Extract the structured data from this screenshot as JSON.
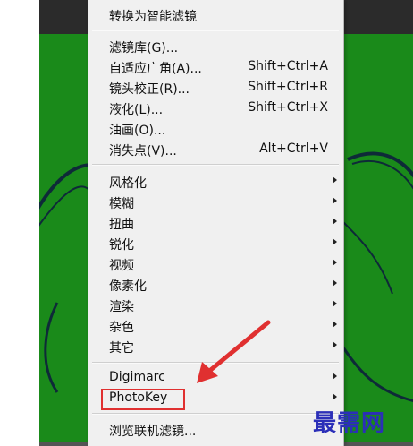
{
  "menu": {
    "items": [
      {
        "label": "转换为智能滤镜"
      },
      {
        "label": "滤镜库(G)..."
      },
      {
        "label": "自适应广角(A)...",
        "shortcut": "Shift+Ctrl+A"
      },
      {
        "label": "镜头校正(R)...",
        "shortcut": "Shift+Ctrl+R"
      },
      {
        "label": "液化(L)...",
        "shortcut": "Shift+Ctrl+X"
      },
      {
        "label": "油画(O)..."
      },
      {
        "label": "消失点(V)...",
        "shortcut": "Alt+Ctrl+V"
      },
      {
        "label": "风格化"
      },
      {
        "label": "模糊"
      },
      {
        "label": "扭曲"
      },
      {
        "label": "锐化"
      },
      {
        "label": "视频"
      },
      {
        "label": "像素化"
      },
      {
        "label": "渲染"
      },
      {
        "label": "杂色"
      },
      {
        "label": "其它"
      },
      {
        "label": "Digimarc"
      },
      {
        "label": "PhotoKey"
      },
      {
        "label": "浏览联机滤镜..."
      }
    ]
  },
  "watermark": "最需网",
  "colors": {
    "canvas_green": "#1a8a1a",
    "highlight_red": "#e03030",
    "watermark_blue": "#2b2fb8"
  },
  "icons": [
    "submenu-arrow-icon",
    "annotation-arrow-icon"
  ]
}
